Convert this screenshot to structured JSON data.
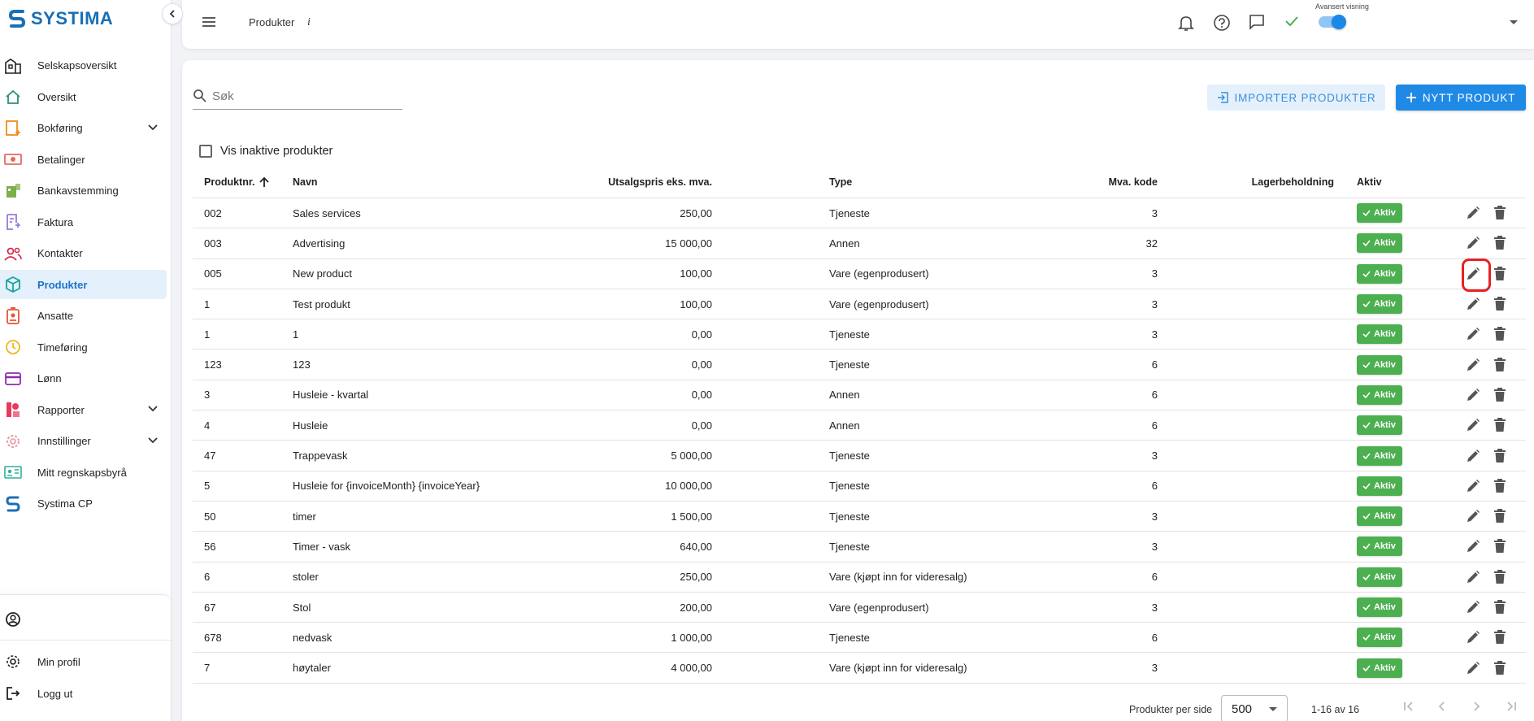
{
  "app": {
    "logo_text": "SYSTIMA"
  },
  "sidebar": {
    "items": [
      {
        "label": "Selskapsoversikt",
        "icon": "building-icon",
        "color": "#222222"
      },
      {
        "label": "Oversikt",
        "icon": "home-icon",
        "color": "#2a8f7a"
      },
      {
        "label": "Bokføring",
        "icon": "ledger-icon",
        "color": "#f08c1a",
        "expandable": true
      },
      {
        "label": "Betalinger",
        "icon": "cash-icon",
        "color": "#e66a5a"
      },
      {
        "label": "Bankavstemming",
        "icon": "bank-icon",
        "color": "#7bb04a"
      },
      {
        "label": "Faktura",
        "icon": "invoice-icon",
        "color": "#9b7ad6"
      },
      {
        "label": "Kontakter",
        "icon": "contacts-icon",
        "color": "#d9284a"
      },
      {
        "label": "Produkter",
        "icon": "cube-icon",
        "color": "#17a2a0",
        "active": true
      },
      {
        "label": "Ansatte",
        "icon": "badge-icon",
        "color": "#e8533a"
      },
      {
        "label": "Timeføring",
        "icon": "clock-icon",
        "color": "#f2b51c"
      },
      {
        "label": "Lønn",
        "icon": "card-icon",
        "color": "#8e2bb0"
      },
      {
        "label": "Rapporter",
        "icon": "report-icon",
        "color": "#e83a5a",
        "expandable": true
      },
      {
        "label": "Innstillinger",
        "icon": "gear-icon",
        "color": "#e89aa8",
        "expandable": true
      },
      {
        "label": "Mitt regnskapsbyrå",
        "icon": "id-card-icon",
        "color": "#2fb09a"
      },
      {
        "label": "Systima CP",
        "icon": "systima-cp-icon",
        "color": "#1a6fb5"
      }
    ],
    "bottom": {
      "profile": "Min profil",
      "logout": "Logg ut"
    }
  },
  "topbar": {
    "title": "Produkter",
    "info": "i",
    "advanced_view_label": "Avansert visning"
  },
  "toolbar": {
    "search_placeholder": "Søk",
    "import_label": "IMPORTER PRODUKTER",
    "new_label": "NYTT PRODUKT",
    "show_inactive_label": "Vis inaktive produkter"
  },
  "table": {
    "columns": {
      "nr": "Produktnr.",
      "name": "Navn",
      "price": "Utsalgspris eks. mva.",
      "type": "Type",
      "mva": "Mva. kode",
      "stock": "Lagerbeholdning",
      "active": "Aktiv"
    },
    "badge_label": "Aktiv",
    "rows": [
      {
        "nr": "002",
        "name": "Sales services",
        "price": "250,00",
        "type": "Tjeneste",
        "mva": "3"
      },
      {
        "nr": "003",
        "name": "Advertising",
        "price": "15 000,00",
        "type": "Annen",
        "mva": "32"
      },
      {
        "nr": "005",
        "name": "New product",
        "price": "100,00",
        "type": "Vare (egenprodusert)",
        "mva": "3"
      },
      {
        "nr": "1",
        "name": "Test produkt",
        "price": "100,00",
        "type": "Vare (egenprodusert)",
        "mva": "3"
      },
      {
        "nr": "1",
        "name": "1",
        "price": "0,00",
        "type": "Tjeneste",
        "mva": "3"
      },
      {
        "nr": "123",
        "name": "123",
        "price": "0,00",
        "type": "Tjeneste",
        "mva": "6"
      },
      {
        "nr": "3",
        "name": "Husleie - kvartal",
        "price": "0,00",
        "type": "Annen",
        "mva": "6"
      },
      {
        "nr": "4",
        "name": "Husleie",
        "price": "0,00",
        "type": "Annen",
        "mva": "6"
      },
      {
        "nr": "47",
        "name": "Trappevask",
        "price": "5 000,00",
        "type": "Tjeneste",
        "mva": "3"
      },
      {
        "nr": "5",
        "name": "Husleie for {invoiceMonth} {invoiceYear}",
        "price": "10 000,00",
        "type": "Tjeneste",
        "mva": "6"
      },
      {
        "nr": "50",
        "name": "timer",
        "price": "1 500,00",
        "type": "Tjeneste",
        "mva": "3"
      },
      {
        "nr": "56",
        "name": "Timer - vask",
        "price": "640,00",
        "type": "Tjeneste",
        "mva": "3"
      },
      {
        "nr": "6",
        "name": "stoler",
        "price": "250,00",
        "type": "Vare (kjøpt inn for videresalg)",
        "mva": "6"
      },
      {
        "nr": "67",
        "name": "Stol",
        "price": "200,00",
        "type": "Vare (egenprodusert)",
        "mva": "3"
      },
      {
        "nr": "678",
        "name": "nedvask",
        "price": "1 000,00",
        "type": "Tjeneste",
        "mva": "6"
      },
      {
        "nr": "7",
        "name": "høytaler",
        "price": "4 000,00",
        "type": "Vare (kjøpt inn for videresalg)",
        "mva": "3"
      }
    ]
  },
  "pagination": {
    "per_page_label": "Produkter per side",
    "per_page_value": "500",
    "range": "1-16 av 16"
  },
  "colors": {
    "accent": "#1f8ae6",
    "active_badge": "#4caf50",
    "highlight": "#e52222"
  }
}
